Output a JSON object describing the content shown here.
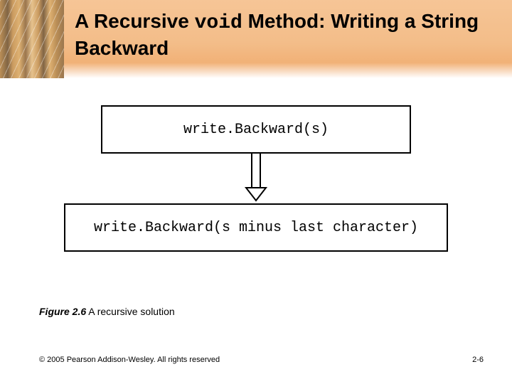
{
  "title": {
    "part1": "A Recursive ",
    "code": "void",
    "part2": " Method: Writing a String Backward"
  },
  "diagram": {
    "box_top": "write.Backward(s)",
    "box_bottom": "write.Backward(s minus last character)"
  },
  "caption": {
    "label": "Figure 2.6",
    "text": "A recursive solution"
  },
  "footer": {
    "copyright": "© 2005 Pearson Addison-Wesley. All rights reserved",
    "page": "2-6"
  }
}
